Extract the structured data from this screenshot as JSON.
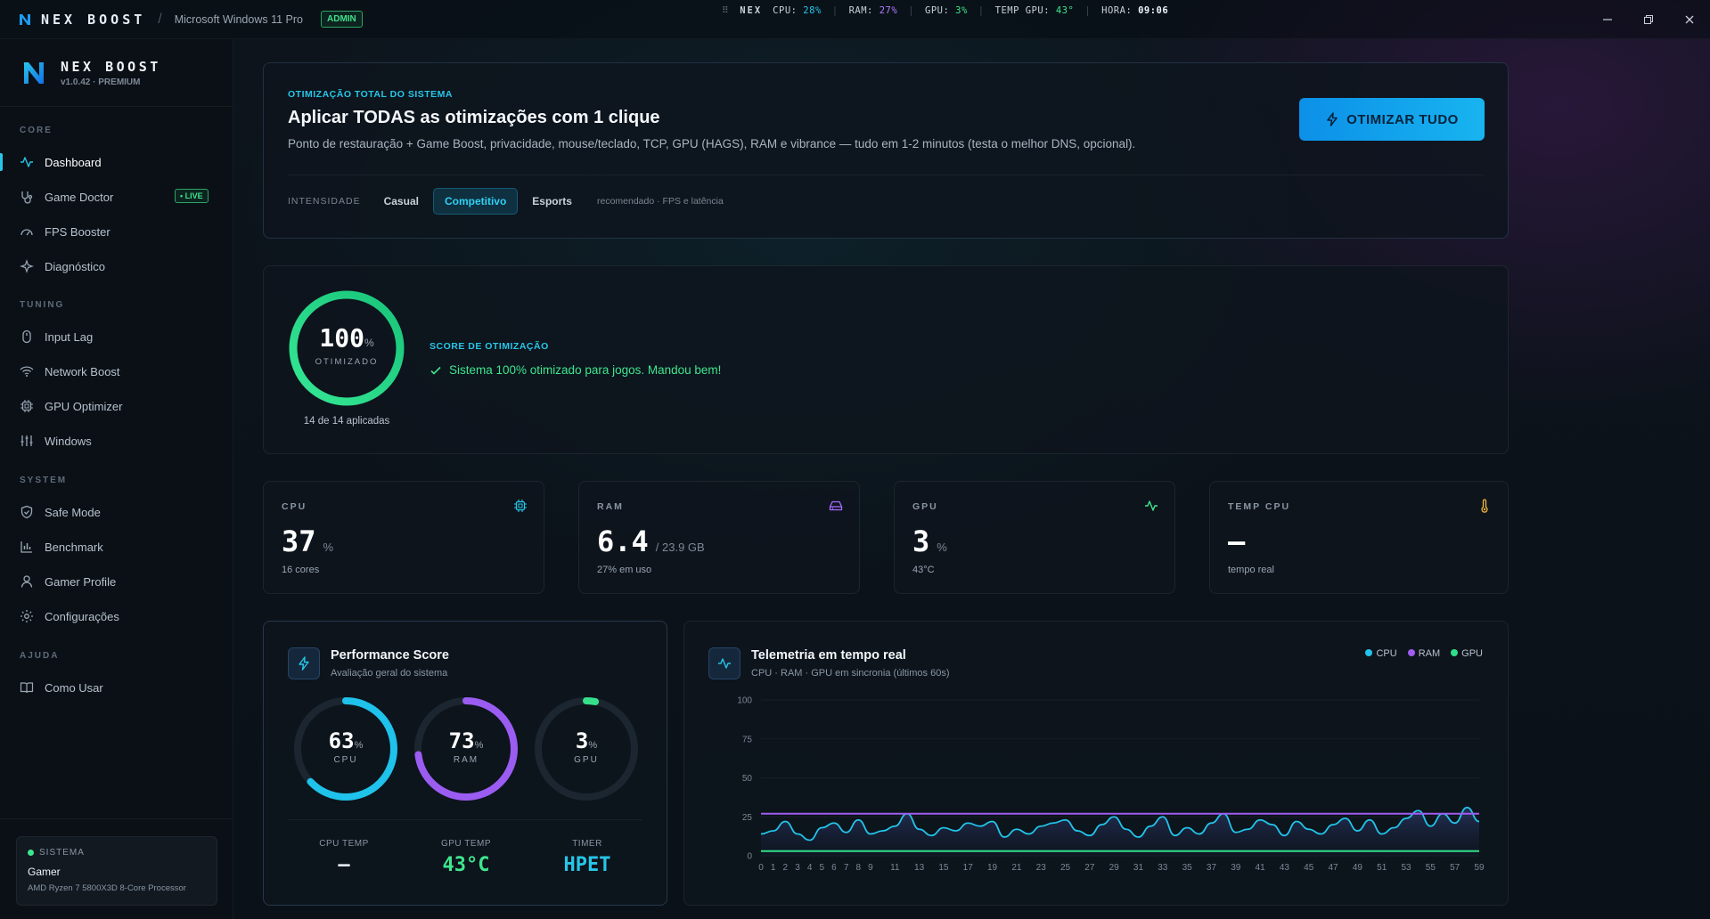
{
  "app": {
    "brand": "NEX BOOST",
    "os": "Microsoft Windows 11 Pro",
    "admin_badge": "ADMIN",
    "version": "v1.0.42 · PREMIUM"
  },
  "topstats": {
    "label": "NEX",
    "cpu_label": "CPU:",
    "cpu": "28%",
    "ram_label": "RAM:",
    "ram": "27%",
    "gpu_label": "GPU:",
    "gpu": "3%",
    "tgpu_label": "TEMP GPU:",
    "tgpu": "43°",
    "time_label": "HORA:",
    "time": "09:06"
  },
  "sidebar": {
    "sections": [
      "CORE",
      "TUNING",
      "SYSTEM",
      "AJUDA"
    ],
    "items": [
      {
        "label": "Dashboard",
        "icon": "activity-icon"
      },
      {
        "label": "Game Doctor",
        "icon": "stethoscope-icon",
        "badge": "• LIVE"
      },
      {
        "label": "FPS Booster",
        "icon": "gauge-icon"
      },
      {
        "label": "Diagnóstico",
        "icon": "sparkles-icon"
      },
      {
        "label": "Input Lag",
        "icon": "mouse-icon"
      },
      {
        "label": "Network Boost",
        "icon": "wifi-icon"
      },
      {
        "label": "GPU Optimizer",
        "icon": "cpu-icon"
      },
      {
        "label": "Windows",
        "icon": "sliders-icon"
      },
      {
        "label": "Safe Mode",
        "icon": "shield-icon"
      },
      {
        "label": "Benchmark",
        "icon": "bar-chart-icon"
      },
      {
        "label": "Gamer Profile",
        "icon": "user-icon"
      },
      {
        "label": "Configurações",
        "icon": "gear-icon"
      },
      {
        "label": "Como Usar",
        "icon": "book-icon"
      }
    ],
    "system_card": {
      "label": "SISTEMA",
      "name": "Gamer",
      "cpu": "AMD Ryzen 7 5800X3D 8-Core Processor"
    }
  },
  "hero": {
    "kicker": "OTIMIZAÇÃO TOTAL DO SISTEMA",
    "title": "Aplicar TODAS as otimizações com 1 clique",
    "description": "Ponto de restauração + Game Boost, privacidade, mouse/teclado, TCP, GPU (HAGS), RAM e vibrance — tudo em 1-2 minutos (testa o melhor DNS, opcional).",
    "button": "OTIMIZAR TUDO",
    "intensity_label": "INTENSIDADE",
    "intensity_options": [
      "Casual",
      "Competitivo",
      "Esports"
    ],
    "intensity_selected": "Competitivo",
    "intensity_note": "recomendado · FPS e latência"
  },
  "score": {
    "value": "100",
    "percent_sign": "%",
    "ring_fraction": 1.0,
    "caption": "OTIMIZADO",
    "applied": "14 de 14 aplicadas",
    "kicker": "SCORE DE OTIMIZAÇÃO",
    "message": "Sistema 100% otimizado para jogos. Mandou bem!"
  },
  "stats": [
    {
      "label": "CPU",
      "value": "37",
      "unit": "%",
      "sub": "16 cores",
      "icon": "cpu-icon",
      "color": "#27c6e8"
    },
    {
      "label": "RAM",
      "value": "6.4",
      "unit": "/ 23.9 GB",
      "sub": "27% em uso",
      "icon": "hard-drive-icon",
      "color": "#a66bff"
    },
    {
      "label": "GPU",
      "value": "3",
      "unit": "%",
      "sub": "43°C",
      "icon": "activity-icon",
      "color": "#3ee68e"
    },
    {
      "label": "TEMP CPU",
      "value": "—",
      "unit": "",
      "sub": "tempo real",
      "icon": "thermometer-icon",
      "color": "#f5b83a"
    }
  ],
  "performance": {
    "title": "Performance Score",
    "subtitle": "Avaliação geral do sistema",
    "gauges": [
      {
        "label": "CPU",
        "value": "63",
        "fraction": 0.63,
        "color": "#1fc2ea"
      },
      {
        "label": "RAM",
        "value": "73",
        "fraction": 0.73,
        "color": "#9b5cf2"
      },
      {
        "label": "GPU",
        "value": "3",
        "fraction": 0.03,
        "color": "#36e08a"
      }
    ],
    "percent_sign": "%",
    "footer": [
      {
        "label": "CPU TEMP",
        "value": "—",
        "color": "#dfe6ee"
      },
      {
        "label": "GPU TEMP",
        "value": "43°C",
        "color": "#3ee68e"
      },
      {
        "label": "TIMER",
        "value": "HPET",
        "color": "#27c6e8"
      }
    ]
  },
  "telemetry": {
    "title": "Telemetria em tempo real",
    "subtitle": "CPU · RAM · GPU em sincronia (últimos 60s)",
    "legend": [
      "CPU",
      "RAM",
      "GPU"
    ],
    "colors": {
      "CPU": "#22c4ea",
      "RAM": "#a05cf0",
      "GPU": "#2fe08a"
    }
  },
  "chart_data": {
    "type": "line",
    "x": [
      0,
      1,
      2,
      3,
      4,
      5,
      6,
      7,
      8,
      9,
      10,
      11,
      12,
      13,
      14,
      15,
      16,
      17,
      18,
      19,
      20,
      21,
      22,
      23,
      24,
      25,
      26,
      27,
      28,
      29,
      30,
      31,
      32,
      33,
      34,
      35,
      36,
      37,
      38,
      39,
      40,
      41,
      42,
      43,
      44,
      45,
      46,
      47,
      48,
      49,
      50,
      51,
      52,
      53,
      54,
      55,
      56,
      57,
      58,
      59
    ],
    "x_tick_labels": [
      "0",
      "1",
      "2",
      "3",
      "4",
      "5",
      "6",
      "7",
      "8",
      "9",
      "11",
      "13",
      "15",
      "17",
      "19",
      "21",
      "23",
      "25",
      "27",
      "29",
      "31",
      "33",
      "35",
      "37",
      "39",
      "41",
      "43",
      "45",
      "47",
      "49",
      "51",
      "53",
      "55",
      "57",
      "59"
    ],
    "ylim": [
      0,
      100
    ],
    "y_ticks": [
      0,
      25,
      50,
      75,
      100
    ],
    "series": [
      {
        "name": "CPU",
        "values": [
          14,
          16,
          22,
          14,
          10,
          18,
          21,
          15,
          23,
          14,
          16,
          19,
          27,
          17,
          13,
          18,
          16,
          21,
          19,
          22,
          12,
          17,
          14,
          19,
          21,
          23,
          16,
          13,
          20,
          25,
          17,
          12,
          19,
          25,
          13,
          18,
          14,
          21,
          27,
          15,
          17,
          23,
          20,
          13,
          22,
          17,
          14,
          20,
          24,
          16,
          23,
          14,
          18,
          24,
          29,
          19,
          27,
          21,
          31,
          22
        ]
      },
      {
        "name": "RAM",
        "values": [
          27,
          27,
          27,
          27,
          27,
          27,
          27,
          27,
          27,
          27,
          27,
          27,
          27,
          27,
          27,
          27,
          27,
          27,
          27,
          27,
          27,
          27,
          27,
          27,
          27,
          27,
          27,
          27,
          27,
          27,
          27,
          27,
          27,
          27,
          27,
          27,
          27,
          27,
          27,
          27,
          27,
          27,
          27,
          27,
          27,
          27,
          27,
          27,
          27,
          27,
          27,
          27,
          27,
          27,
          27,
          27,
          27,
          27,
          27,
          27
        ]
      },
      {
        "name": "GPU",
        "values": [
          3,
          3,
          3,
          3,
          3,
          3,
          3,
          3,
          3,
          3,
          3,
          3,
          3,
          3,
          3,
          3,
          3,
          3,
          3,
          3,
          3,
          3,
          3,
          3,
          3,
          3,
          3,
          3,
          3,
          3,
          3,
          3,
          3,
          3,
          3,
          3,
          3,
          3,
          3,
          3,
          3,
          3,
          3,
          3,
          3,
          3,
          3,
          3,
          3,
          3,
          3,
          3,
          3,
          3,
          3,
          3,
          3,
          3,
          3,
          3
        ]
      }
    ]
  }
}
